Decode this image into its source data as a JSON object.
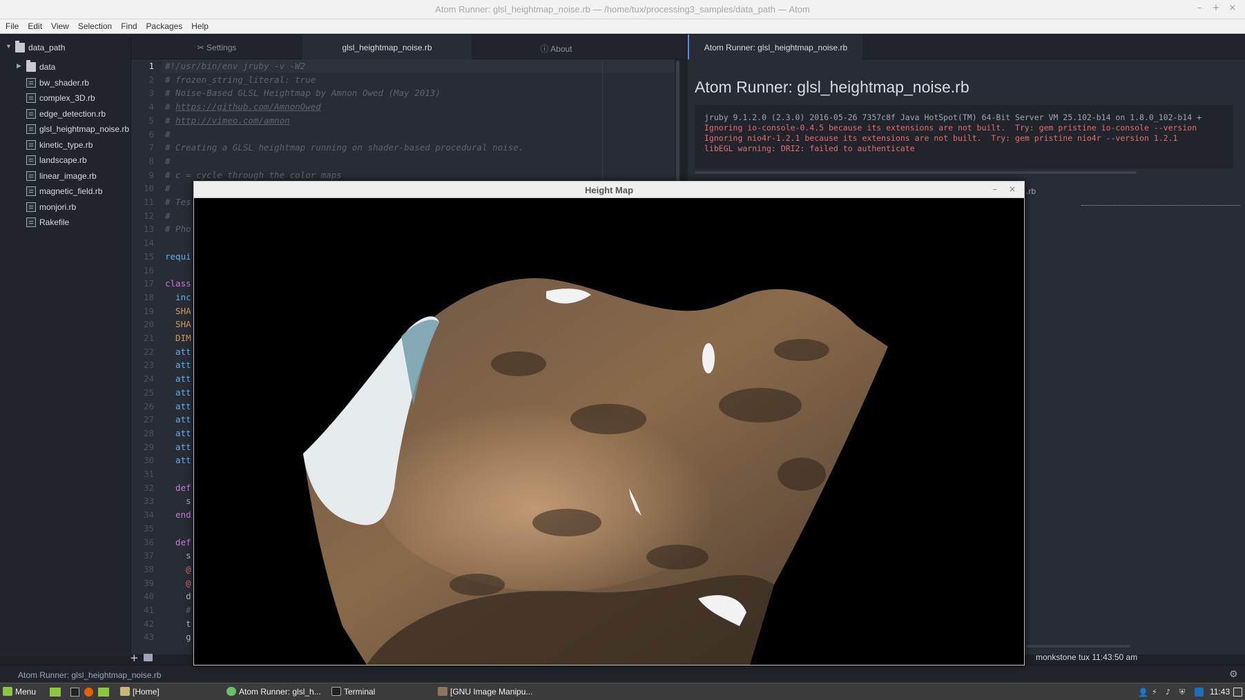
{
  "window": {
    "title": "Atom Runner: glsl_heightmap_noise.rb — /home/tux/processing3_samples/data_path — Atom",
    "min": "–",
    "max": "+",
    "close": "×"
  },
  "menu": [
    "File",
    "Edit",
    "View",
    "Selection",
    "Find",
    "Packages",
    "Help"
  ],
  "tree": {
    "root": "data_path",
    "items": [
      {
        "label": "data",
        "type": "folder"
      },
      {
        "label": "bw_shader.rb",
        "type": "file"
      },
      {
        "label": "complex_3D.rb",
        "type": "file"
      },
      {
        "label": "edge_detection.rb",
        "type": "file"
      },
      {
        "label": "glsl_heightmap_noise.rb",
        "type": "file"
      },
      {
        "label": "kinetic_type.rb",
        "type": "file"
      },
      {
        "label": "landscape.rb",
        "type": "file"
      },
      {
        "label": "linear_image.rb",
        "type": "file"
      },
      {
        "label": "magnetic_field.rb",
        "type": "file"
      },
      {
        "label": "monjori.rb",
        "type": "file"
      },
      {
        "label": "Rakefile",
        "type": "file"
      }
    ]
  },
  "tabs": {
    "settings": "Settings",
    "active": "glsl_heightmap_noise.rb",
    "about": "About"
  },
  "editor": {
    "current_line": 1,
    "lines": [
      {
        "n": "1",
        "parts": [
          {
            "c": "cmt",
            "t": "#!/usr/bin/env jruby -v -W2"
          }
        ]
      },
      {
        "n": "2",
        "parts": [
          {
            "c": "cmt",
            "t": "# frozen_string_literal: true"
          }
        ]
      },
      {
        "n": "3",
        "parts": [
          {
            "c": "cmt",
            "t": "# Noise-Based GLSL Heightmap by Amnon Owed (May 2013)"
          }
        ]
      },
      {
        "n": "4",
        "parts": [
          {
            "c": "cmt",
            "t": "# "
          },
          {
            "c": "cmt-u",
            "t": "https://github.com/AmnonOwed"
          }
        ]
      },
      {
        "n": "5",
        "parts": [
          {
            "c": "cmt",
            "t": "# "
          },
          {
            "c": "cmt-u",
            "t": "http://vimeo.com/amnon"
          }
        ]
      },
      {
        "n": "6",
        "parts": [
          {
            "c": "cmt",
            "t": "#"
          }
        ]
      },
      {
        "n": "7",
        "parts": [
          {
            "c": "cmt",
            "t": "# Creating a GLSL heightmap running on shader-based procedural noise."
          }
        ]
      },
      {
        "n": "8",
        "parts": [
          {
            "c": "cmt",
            "t": "#"
          }
        ]
      },
      {
        "n": "9",
        "parts": [
          {
            "c": "cmt",
            "t": "# c = cycle through the color maps"
          }
        ]
      },
      {
        "n": "10",
        "parts": [
          {
            "c": "cmt",
            "t": "#"
          }
        ]
      },
      {
        "n": "11",
        "parts": [
          {
            "c": "cmt",
            "t": "# Tes"
          }
        ]
      },
      {
        "n": "12",
        "parts": [
          {
            "c": "cmt",
            "t": "#"
          }
        ]
      },
      {
        "n": "13",
        "parts": [
          {
            "c": "cmt",
            "t": "# Pho"
          }
        ]
      },
      {
        "n": "14",
        "parts": []
      },
      {
        "n": "15",
        "parts": [
          {
            "c": "fn",
            "t": "requi"
          }
        ]
      },
      {
        "n": "16",
        "parts": []
      },
      {
        "n": "17",
        "parts": [
          {
            "c": "kw",
            "t": "class"
          }
        ]
      },
      {
        "n": "18",
        "parts": [
          {
            "c": "fn",
            "t": "  inc"
          }
        ]
      },
      {
        "n": "19",
        "parts": [
          {
            "c": "const",
            "t": "  SHA"
          }
        ]
      },
      {
        "n": "20",
        "parts": [
          {
            "c": "const",
            "t": "  SHA"
          }
        ]
      },
      {
        "n": "21",
        "parts": [
          {
            "c": "const",
            "t": "  DIM"
          }
        ]
      },
      {
        "n": "22",
        "parts": [
          {
            "c": "fn",
            "t": "  att"
          }
        ]
      },
      {
        "n": "23",
        "parts": [
          {
            "c": "fn",
            "t": "  att"
          }
        ]
      },
      {
        "n": "24",
        "parts": [
          {
            "c": "fn",
            "t": "  att"
          }
        ]
      },
      {
        "n": "25",
        "parts": [
          {
            "c": "fn",
            "t": "  att"
          }
        ]
      },
      {
        "n": "26",
        "parts": [
          {
            "c": "fn",
            "t": "  att"
          }
        ]
      },
      {
        "n": "27",
        "parts": [
          {
            "c": "fn",
            "t": "  att"
          }
        ]
      },
      {
        "n": "28",
        "parts": [
          {
            "c": "fn",
            "t": "  att"
          }
        ]
      },
      {
        "n": "29",
        "parts": [
          {
            "c": "fn",
            "t": "  att"
          }
        ]
      },
      {
        "n": "30",
        "parts": [
          {
            "c": "fn",
            "t": "  att"
          }
        ]
      },
      {
        "n": "31",
        "parts": []
      },
      {
        "n": "32",
        "parts": [
          {
            "c": "kw",
            "t": "  def"
          }
        ]
      },
      {
        "n": "33",
        "parts": [
          {
            "c": "plain",
            "t": "    s"
          }
        ]
      },
      {
        "n": "34",
        "parts": [
          {
            "c": "kw",
            "t": "  end"
          }
        ]
      },
      {
        "n": "35",
        "parts": []
      },
      {
        "n": "36",
        "parts": [
          {
            "c": "kw",
            "t": "  def"
          }
        ]
      },
      {
        "n": "37",
        "parts": [
          {
            "c": "plain",
            "t": "    s"
          }
        ]
      },
      {
        "n": "38",
        "parts": [
          {
            "c": "ivar",
            "t": "    @"
          }
        ]
      },
      {
        "n": "39",
        "parts": [
          {
            "c": "ivar",
            "t": "    @"
          }
        ]
      },
      {
        "n": "40",
        "parts": [
          {
            "c": "plain",
            "t": "    d"
          }
        ]
      },
      {
        "n": "41",
        "parts": [
          {
            "c": "cmt",
            "t": "    #"
          }
        ]
      },
      {
        "n": "42",
        "parts": [
          {
            "c": "plain",
            "t": "    t"
          }
        ]
      },
      {
        "n": "43",
        "parts": [
          {
            "c": "plain",
            "t": "    g"
          }
        ]
      }
    ]
  },
  "runner": {
    "tab": "Atom Runner: glsl_heightmap_noise.rb",
    "title": "Atom Runner: glsl_heightmap_noise.rb",
    "output": [
      {
        "c": "out-white",
        "t": "jruby 9.1.2.0 (2.3.0) 2016-05-26 7357c8f Java HotSpot(TM) 64-Bit Server VM 25.102-b14 on 1.8.0_102-b14 +"
      },
      {
        "c": "out-red",
        "t": "Ignoring io-console-0.4.5 because its extensions are not built.  Try: gem pristine io-console --version"
      },
      {
        "c": "out-red",
        "t": "Ignoring nio4r-1.2.1 because its extensions are not built.  Try: gem pristine nio4r --version 1.2.1"
      },
      {
        "c": "out-red",
        "t": "libEGL warning: DRI2: failed to authenticate"
      }
    ],
    "footer": ".rb",
    "status": "monkstone tux 11:43:50 am"
  },
  "statusbar": {
    "text": "Atom Runner: glsl_heightmap_noise.rb",
    "add": "+"
  },
  "heightmap": {
    "title": "Height Map",
    "min": "–",
    "close": "×"
  },
  "taskbar": {
    "menu": "Menu",
    "items": [
      "[Home]",
      "Atom Runner: glsl_h...",
      "Terminal",
      "[GNU Image Manipu..."
    ],
    "time": "11:43"
  }
}
